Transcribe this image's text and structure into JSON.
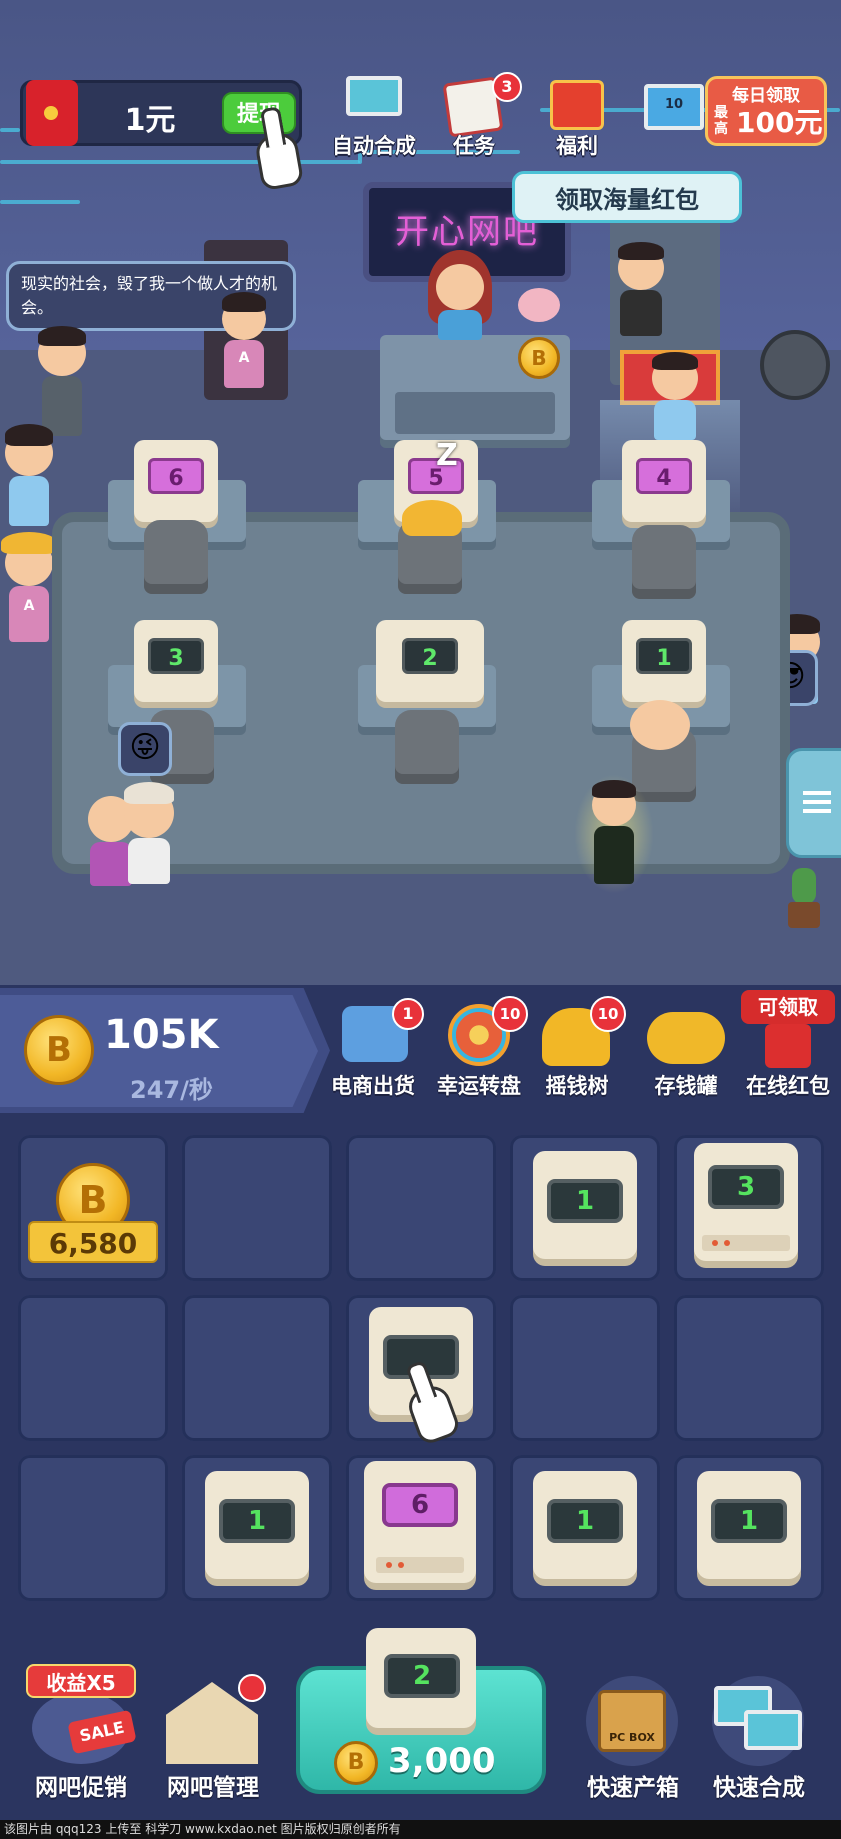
{
  "top_bar": {
    "cash_amount": "1元",
    "withdraw_label": "提现",
    "auto_merge_label": "自动合成",
    "tasks_label": "任务",
    "tasks_badge": "3",
    "welfare_label": "福利",
    "welfare_tip": "领取海量红包",
    "daily": {
      "line1": "每日领取",
      "prefix": "最高",
      "amount": "100元",
      "pc_number": "10"
    }
  },
  "scene": {
    "sign": "开心网吧",
    "speech_bubble": "现实的社会，毁了我一个做人才的机会。",
    "row1_levels": [
      "6",
      "5",
      "4"
    ],
    "row2_levels": [
      "3",
      "2",
      "1"
    ],
    "sleep_marker": "Z",
    "shirt_letter": "A",
    "coin_symbol": "B"
  },
  "status": {
    "coins_total": "105K",
    "coins_rate": "247/秒",
    "coin_symbol": "B",
    "features": [
      {
        "label": "电商出货",
        "badge": "1",
        "icon": "delivery-truck-icon"
      },
      {
        "label": "幸运转盘",
        "badge": "10",
        "icon": "lucky-wheel-icon"
      },
      {
        "label": "摇钱树",
        "badge": "10",
        "icon": "money-tree-icon"
      },
      {
        "label": "存钱罐",
        "badge": "",
        "icon": "piggy-bank-icon"
      },
      {
        "label": "在线红包",
        "badge": "可领取",
        "icon": "red-envelope-icon"
      }
    ]
  },
  "grid": {
    "coin_reward": "6,580",
    "coin_symbol": "B",
    "cells": [
      {
        "row": 1,
        "col": 1,
        "type": "coin"
      },
      {
        "row": 1,
        "col": 2,
        "type": "empty"
      },
      {
        "row": 1,
        "col": 3,
        "type": "empty"
      },
      {
        "row": 1,
        "col": 4,
        "type": "pc",
        "level": "1"
      },
      {
        "row": 1,
        "col": 5,
        "type": "pc",
        "level": "3"
      },
      {
        "row": 2,
        "col": 1,
        "type": "empty"
      },
      {
        "row": 2,
        "col": 2,
        "type": "empty"
      },
      {
        "row": 2,
        "col": 3,
        "type": "pc",
        "level": ""
      },
      {
        "row": 2,
        "col": 4,
        "type": "empty"
      },
      {
        "row": 2,
        "col": 5,
        "type": "empty"
      },
      {
        "row": 3,
        "col": 1,
        "type": "empty"
      },
      {
        "row": 3,
        "col": 2,
        "type": "pc",
        "level": "1"
      },
      {
        "row": 3,
        "col": 3,
        "type": "pc",
        "level": "6"
      },
      {
        "row": 3,
        "col": 4,
        "type": "pc",
        "level": "1"
      },
      {
        "row": 3,
        "col": 5,
        "type": "pc",
        "level": "1"
      }
    ]
  },
  "bottom": {
    "promo_badge": "收益X5",
    "promo_sale": "SALE",
    "promo_label": "网吧促销",
    "manage_label": "网吧管理",
    "buy_level": "2",
    "buy_price": "3,000",
    "coin_symbol": "B",
    "box_text": "PC BOX",
    "quick_box_label": "快速产箱",
    "quick_merge_label": "快速合成"
  },
  "footer": "该图片由 qqq123 上传至 科学刀 www.kxdao.net 图片版权归原创者所有",
  "colors": {
    "accent_teal": "#3fc9ba",
    "badge_red": "#e8323a",
    "coin_gold": "#f2b726",
    "screen_green": "#55e35f",
    "screen_pink": "#d06cdb"
  }
}
